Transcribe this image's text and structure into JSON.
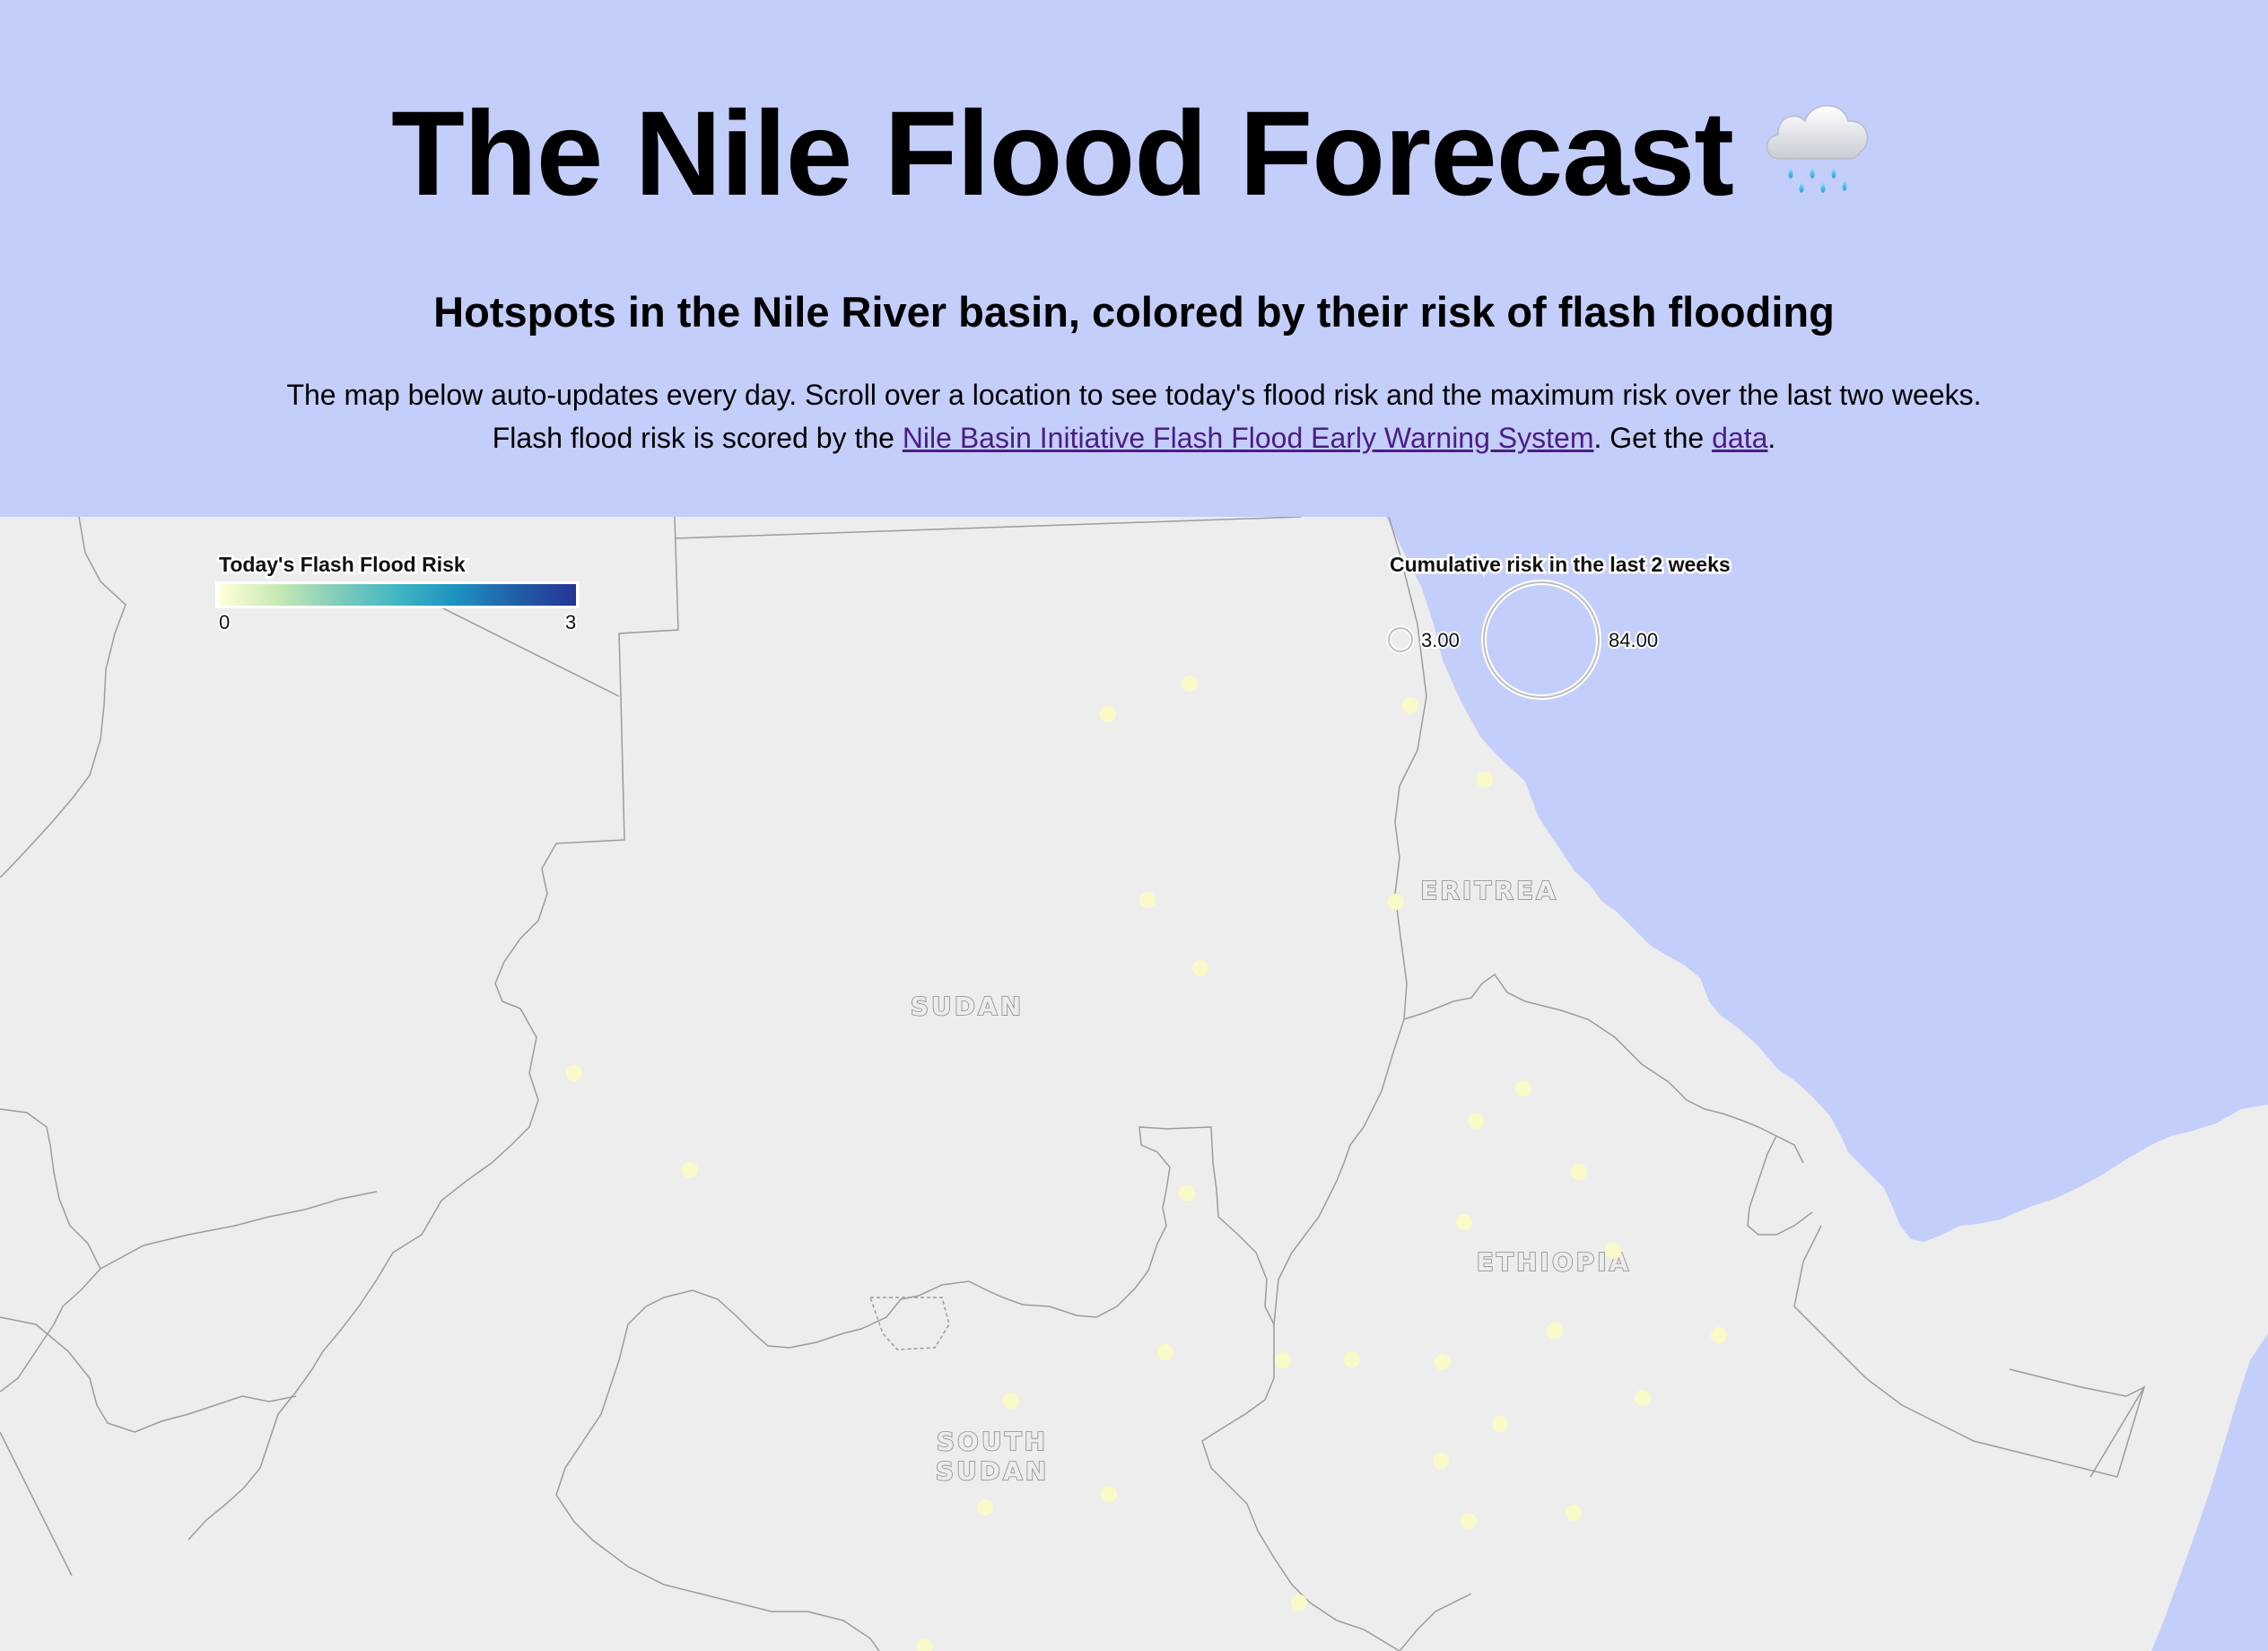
{
  "header": {
    "title": "The Nile Flood Forecast",
    "title_icon": "cloud-with-rain-icon",
    "subtitle": "Hotspots in the Nile River basin, colored by their risk of flash flooding",
    "intro_line1": "The map below auto-updates every day. Scroll over a location to see today's flood risk and the maximum risk over the last two weeks.",
    "intro_line2_before": "Flash flood risk is scored by the ",
    "intro_link_text": "Nile Basin Initiative Flash Flood Early Warning System",
    "intro_line2_middle": ". Get the ",
    "data_link_text": "data",
    "intro_line2_after": "."
  },
  "legend_risk": {
    "title": "Today's Flash Flood Risk",
    "min_label": "0",
    "max_label": "3",
    "min": 0,
    "max": 3,
    "colors": [
      "#ffffd9",
      "#c7e9b4",
      "#7fcdbb",
      "#41b6c4",
      "#1d91c0",
      "#225ea8",
      "#253494"
    ]
  },
  "legend_cumulative": {
    "title": "Cumulative risk in the last 2 weeks",
    "small_label": "3.00",
    "large_label": "84.00",
    "small_value": 3,
    "large_value": 84
  },
  "countries": [
    {
      "name": "SUDAN"
    },
    {
      "name": "ERITREA"
    },
    {
      "name": "ETHIOPIA"
    },
    {
      "name_lines": [
        "SOUTH",
        "SUDAN"
      ]
    }
  ],
  "colors": {
    "background": "#c4cefa",
    "land": "#ededed",
    "border": "#9a9a9a",
    "hotspot": "#fafac8",
    "link": "#4b1d86"
  }
}
